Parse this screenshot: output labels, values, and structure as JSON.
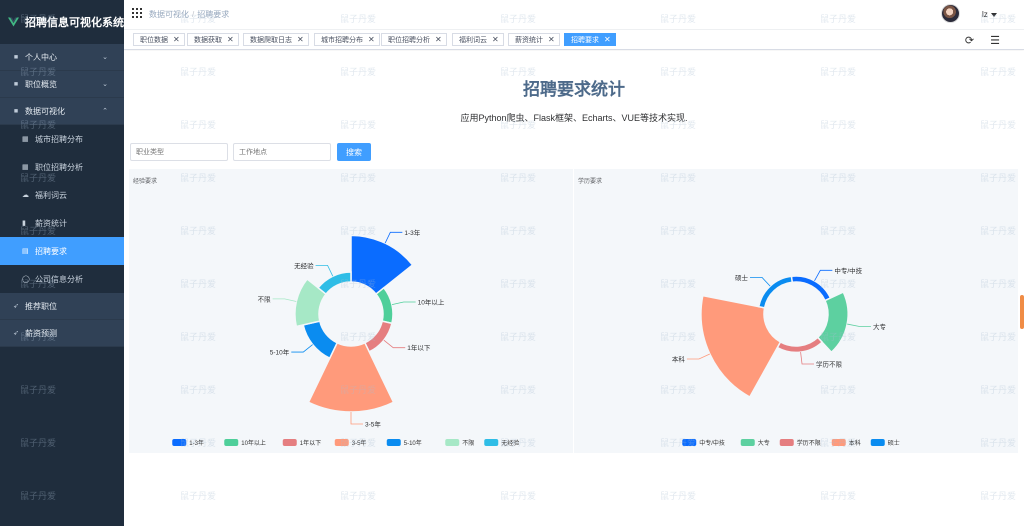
{
  "brand": {
    "title": "招聘信息可视化系统"
  },
  "sidebar": {
    "items": [
      {
        "label": "个人中心",
        "icon": "user-icon",
        "chevron": "⌄"
      },
      {
        "label": "职位概览",
        "icon": "list-icon",
        "chevron": "⌄"
      },
      {
        "label": "数据可视化",
        "icon": "chart-icon",
        "chevron": "⌃"
      }
    ],
    "subitems": [
      {
        "label": "城市招聘分布",
        "icon": "grid-icon"
      },
      {
        "label": "职位招聘分析",
        "icon": "grid-icon"
      },
      {
        "label": "福利词云",
        "icon": "cloud-icon"
      },
      {
        "label": "薪资统计",
        "icon": "bar-icon"
      },
      {
        "label": "招聘要求",
        "icon": "doc-icon",
        "active": true
      },
      {
        "label": "公司信息分析",
        "icon": "circle-icon"
      }
    ],
    "bottom_items": [
      {
        "label": "推荐职位",
        "icon": "send-icon"
      },
      {
        "label": "薪资预测",
        "icon": "send-icon"
      }
    ]
  },
  "navbar": {
    "breadcrumb": [
      "数据可视化",
      "招聘要求"
    ],
    "username": "lz"
  },
  "tags": [
    {
      "label": "职位数据",
      "close": "✕"
    },
    {
      "label": "数据获取",
      "close": "✕"
    },
    {
      "label": "数据爬取日志",
      "close": "✕"
    },
    {
      "label": "城市招聘分布",
      "close": "✕"
    },
    {
      "label": "职位招聘分析",
      "close": "✕"
    },
    {
      "label": "福利词云",
      "close": "✕"
    },
    {
      "label": "薪资统计",
      "close": "✕"
    },
    {
      "label": "招聘要求",
      "close": "✕",
      "active": true
    }
  ],
  "tools": {
    "refresh": "⟳",
    "settings": "☰"
  },
  "main": {
    "title": "招聘要求统计",
    "subtitle": "应用Python爬虫、Flask框架、Echarts、VUE等技术实现.",
    "search": {
      "type_placeholder": "职业类型",
      "location_placeholder": "工作地点",
      "button_label": "搜索"
    }
  },
  "watermark_text": "鼠子丹爱",
  "colors": {
    "accent": "#409eff",
    "sidebar_bg": "#1f2d3d",
    "sidebar_item_bg": "#304156"
  },
  "chart_data": [
    {
      "type": "pie",
      "title": "经验要求",
      "variant": "rose-donut",
      "categories": [
        "1-3年",
        "10年以上",
        "1年以下",
        "3-5年",
        "5-10年",
        "不限",
        "无经验"
      ],
      "values": [
        30,
        0.6,
        0.8,
        60,
        4,
        8,
        0.8
      ],
      "colors": [
        "#0a6cff",
        "#4fcf9a",
        "#e57e80",
        "#ff9a7b",
        "#0a8cf0",
        "#a6e8c6",
        "#2fbde6"
      ],
      "legend": "bottom"
    },
    {
      "type": "pie",
      "title": "学历要求",
      "variant": "rose-donut",
      "categories": [
        "中专/中技",
        "大专",
        "学历不限",
        "本科",
        "硕士"
      ],
      "values": [
        0.6,
        9,
        0.9,
        88,
        0.6
      ],
      "colors": [
        "#0a6cff",
        "#5dd0a0",
        "#e57e80",
        "#ff9a7b",
        "#0a8cf0"
      ],
      "legend": "bottom"
    }
  ]
}
